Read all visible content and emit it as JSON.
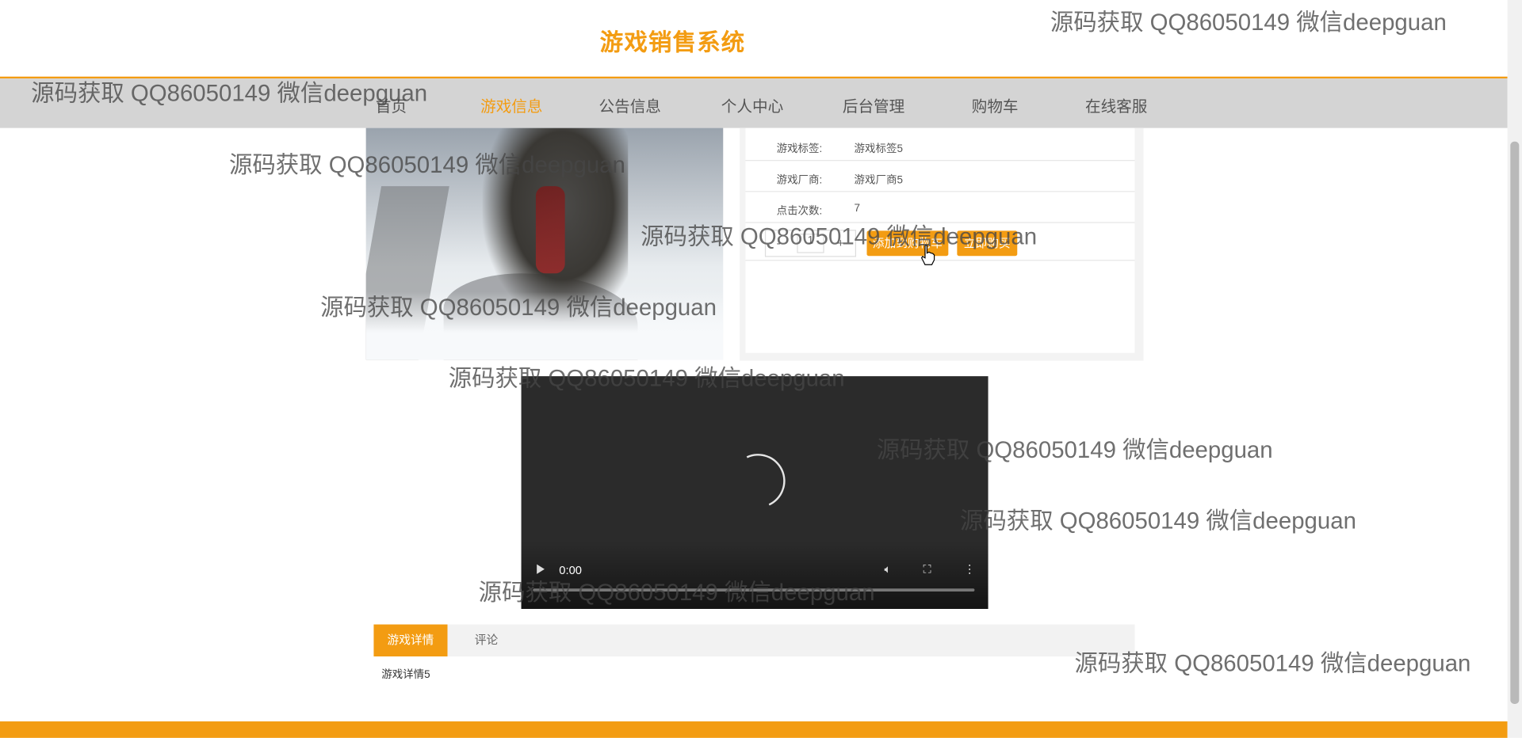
{
  "header": {
    "site_title": "游戏销售系统",
    "accent_color": "#f39c12"
  },
  "nav": {
    "items": [
      {
        "label": "首页"
      },
      {
        "label": "游戏信息",
        "active": true
      },
      {
        "label": "公告信息"
      },
      {
        "label": "个人中心"
      },
      {
        "label": "后台管理"
      },
      {
        "label": "购物车"
      },
      {
        "label": "在线客服"
      }
    ]
  },
  "product": {
    "rows": [
      {
        "label": "游戏标签:",
        "value": "游戏标签5"
      },
      {
        "label": "游戏厂商:",
        "value": "游戏厂商5"
      },
      {
        "label": "点击次数:",
        "value": "7"
      }
    ],
    "quantity": {
      "minus": "-",
      "value": "1",
      "plus": "+"
    },
    "add_to_cart": "添加到购物车",
    "buy_now": "立即购买"
  },
  "video": {
    "time": "0:00"
  },
  "tabs": [
    {
      "label": "游戏详情",
      "active": true
    },
    {
      "label": "评论"
    }
  ],
  "detail_text": "游戏详情5",
  "watermark_text": "源码获取 QQ86050149 微信deepguan"
}
